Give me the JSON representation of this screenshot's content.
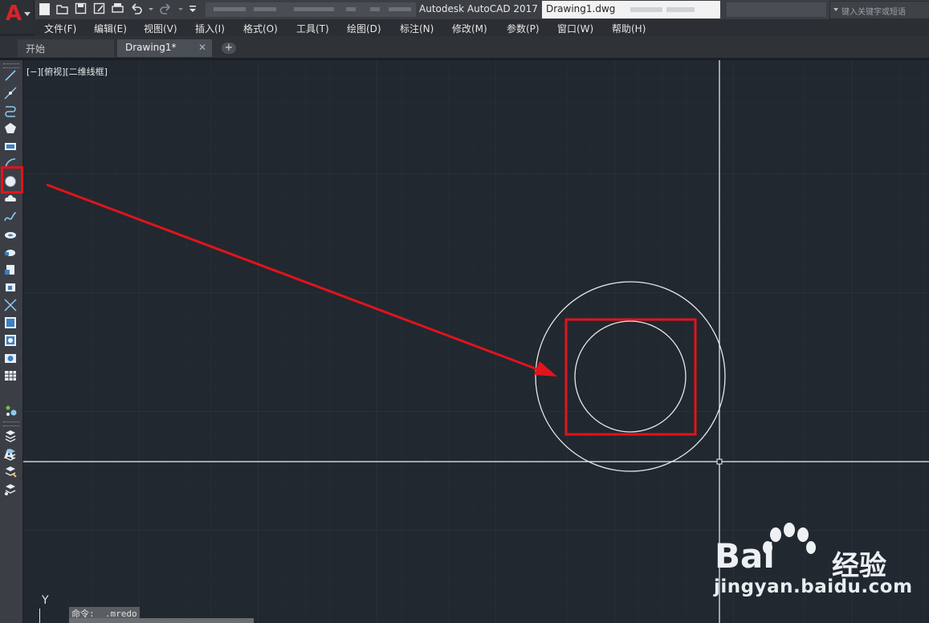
{
  "app_button": {
    "letter": "A"
  },
  "title_bar": {
    "app_title": "Autodesk AutoCAD 2017",
    "file_name": "Drawing1.dwg",
    "search_placeholder": "键入关键字或短语"
  },
  "menu": [
    "文件(F)",
    "编辑(E)",
    "视图(V)",
    "插入(I)",
    "格式(O)",
    "工具(T)",
    "绘图(D)",
    "标注(N)",
    "修改(M)",
    "参数(P)",
    "窗口(W)",
    "帮助(H)"
  ],
  "tabs": [
    {
      "label": "开始"
    },
    {
      "label": "Drawing1*",
      "close": "✕"
    }
  ],
  "tab_add": "+",
  "viewport_label": "[−][俯视][二维线框]",
  "toolbar_tools": [
    "line-icon",
    "construction-line-icon",
    "polyline-icon",
    "polygon-icon",
    "rectangle-icon",
    "arc-icon",
    "circle-icon",
    "revision-cloud-icon",
    "spline-icon",
    "ellipse-icon",
    "insert-block-icon",
    "make-block-icon",
    "point-icon",
    "hatch-icon",
    "gradient-icon",
    "region-icon",
    "table-icon",
    "multiline-text-icon",
    "add-selected-icon"
  ],
  "text_tool_glyph": "A",
  "command_line": {
    "history": "命令: _.mredo"
  },
  "ucs": {
    "y_label": "Y"
  },
  "watermark": {
    "brand": "Bai",
    "brand_suffix": "经验",
    "url": "jingyan.baidu.com"
  },
  "colors": {
    "canvas": "#212830",
    "grid": "#2b333d",
    "annotation_red": "#e1141b",
    "geometry": "#ffffff"
  }
}
